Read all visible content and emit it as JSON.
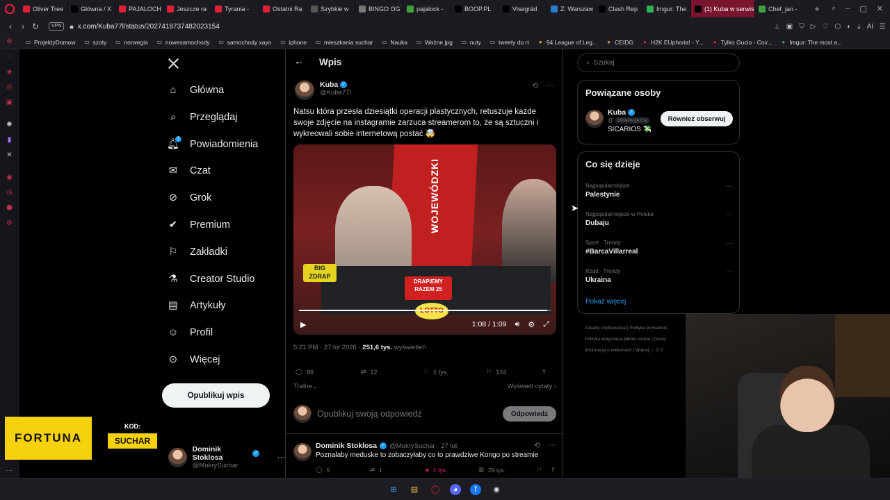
{
  "browser": {
    "tabs": [
      {
        "label": "Oliver Tree",
        "favicon_color": "#e0203a",
        "active": false
      },
      {
        "label": "Główna / X",
        "favicon_color": "#000000",
        "active": false
      },
      {
        "label": "PAJALOCH",
        "favicon_color": "#e0203a",
        "active": false
      },
      {
        "label": "Jeszcze ra",
        "favicon_color": "#e0203a",
        "active": false
      },
      {
        "label": "Tyrania -",
        "favicon_color": "#e0203a",
        "active": false
      },
      {
        "label": "Ostatni Ra",
        "favicon_color": "#e0203a",
        "active": false
      },
      {
        "label": "Szybkie w",
        "favicon_color": "#555555",
        "active": false
      },
      {
        "label": "BINGO OG",
        "favicon_color": "#777777",
        "active": false
      },
      {
        "label": "pajalock -",
        "favicon_color": "#40a040",
        "active": false
      },
      {
        "label": "BOOP.PL",
        "favicon_color": "#000000",
        "active": false
      },
      {
        "label": "Visegrád",
        "favicon_color": "#000000",
        "active": false
      },
      {
        "label": "Z: Warszaw",
        "favicon_color": "#2a7ad0",
        "active": false
      },
      {
        "label": "Clash Rep",
        "favicon_color": "#000000",
        "active": false
      },
      {
        "label": "Imgur: The",
        "favicon_color": "#30b050",
        "active": false
      },
      {
        "label": "(1) Kuba w serwisie",
        "favicon_color": "#000000",
        "active": true
      },
      {
        "label": "Chef_jan -",
        "favicon_color": "#40a040",
        "active": false
      }
    ],
    "new_tab": "+",
    "vpn_label": "VPN",
    "url": "x.com/Kuba77l/status/2027418737482023154",
    "ai_label": "AI"
  },
  "bookmarks": [
    {
      "label": "ProjektyDomow",
      "icon": "folder-icon"
    },
    {
      "label": "szoty",
      "icon": "folder-icon"
    },
    {
      "label": "norwegia",
      "icon": "folder-icon"
    },
    {
      "label": "nowesamochody",
      "icon": "folder-icon"
    },
    {
      "label": "samochody xayo",
      "icon": "folder-icon"
    },
    {
      "label": "iphone",
      "icon": "folder-icon"
    },
    {
      "label": "mieszkania suchar",
      "icon": "folder-icon"
    },
    {
      "label": "Nauka",
      "icon": "folder-icon"
    },
    {
      "label": "Ważne jpg",
      "icon": "folder-icon"
    },
    {
      "label": "nuty",
      "icon": "folder-icon"
    },
    {
      "label": "tweety do rt",
      "icon": "folder-icon"
    },
    {
      "label": "94 League of Leg...",
      "icon": "lol-icon"
    },
    {
      "label": "CEIDG",
      "icon": "ceidg-icon"
    },
    {
      "label": "H2K EUphoria! - Y...",
      "icon": "youtube-icon"
    },
    {
      "label": "Tylko Gucio - Cov...",
      "icon": "youtube-icon"
    },
    {
      "label": "Imgur: The most a...",
      "icon": "imgur-icon"
    }
  ],
  "nav": {
    "items": [
      {
        "label": "Główna",
        "icon": "home-icon"
      },
      {
        "label": "Przeglądaj",
        "icon": "search-icon"
      },
      {
        "label": "Powiadomienia",
        "icon": "bell-icon",
        "badge": "1"
      },
      {
        "label": "Czat",
        "icon": "mail-icon"
      },
      {
        "label": "Grok",
        "icon": "grok-icon"
      },
      {
        "label": "Premium",
        "icon": "premium-icon"
      },
      {
        "label": "Zakładki",
        "icon": "bookmark-icon"
      },
      {
        "label": "Creator Studio",
        "icon": "flask-icon"
      },
      {
        "label": "Artykuły",
        "icon": "article-icon"
      },
      {
        "label": "Profil",
        "icon": "profile-icon"
      },
      {
        "label": "Więcej",
        "icon": "more-icon"
      }
    ],
    "post_button": "Opublikuj wpis",
    "account": {
      "name": "Dominik Stoklosa",
      "handle": "@MokrySuchar"
    }
  },
  "post": {
    "header_title": "Wpis",
    "author_name": "Kuba",
    "author_handle": "@Kuba77l",
    "text": "Natsu która przesła dziesiątki operacji plastycznych, retuszuje każde swoje zdjęcie na instagramie zarzuca streamerom to, że są sztuczni i wykreowali sobie internetową postać 🤯",
    "video": {
      "time": "1:08 / 1:09",
      "progress": 0.985,
      "sign_text": "WOJEWÓDZKI",
      "tag1": "BIG ZDRAP",
      "tag2": "DRAPIEMY RAZEM 25",
      "lotto": "LOTTO"
    },
    "timestamp": "5:21 PM · 27 lut 2026 · ",
    "views_count": "251,6 tys.",
    "views_label": " wyświetleń",
    "stats": {
      "replies": "88",
      "reposts": "12",
      "likes": "1 tys.",
      "bookmarks": "134"
    },
    "sort_label": "Trafne",
    "quotes_label": "Wyświetl cytaty",
    "reply_placeholder": "Opublikuj swoją odpowiedź",
    "reply_button": "Odpowiedz"
  },
  "reply": {
    "author_name": "Dominik Stoklosa",
    "author_handle": "@MokrySuchar · 27 lut",
    "text": "Poznałaby meduske to zobaczyłaby co to prawdziwe Kongo po streamie",
    "stats": {
      "replies": "5",
      "reposts": "1",
      "likes": "1 tys.",
      "views": "29 tys."
    }
  },
  "sidebar": {
    "search_placeholder": "Szukaj",
    "people_title": "Powiązane osoby",
    "person": {
      "name": "Kuba",
      "follows_you": "Obserwuje Cię",
      "bio": "SICARIOS 💸",
      "button": "Również obserwuj"
    },
    "trends_title": "Co się dzieje",
    "trends": [
      {
        "category": "Najpopularniejsze",
        "name": "Palestynie"
      },
      {
        "category": "Najpopularniejsze w Polska",
        "name": "Dubaju"
      },
      {
        "category": "Sport · Trendy",
        "name": "#BarcaVillarreal"
      },
      {
        "category": "Rząd · Trendy",
        "name": "Ukraina"
      }
    ],
    "show_more": "Pokaż więcej",
    "footer_line1": "Zasady użytkowania | Polityka prywatnoś",
    "footer_line2": "Polityka dotycząca plików cookie | Dostę",
    "footer_line3": "Informacja o reklamach | Więcej ··· © 2"
  },
  "overlay": {
    "fortuna": "FORTUNA",
    "kod_label": "KOD:",
    "kod_value": "SUCHAR"
  },
  "colors": {
    "accent": "#1d9bf0",
    "active_tab": "#7a1530",
    "fortuna_yellow": "#f5d10e"
  }
}
